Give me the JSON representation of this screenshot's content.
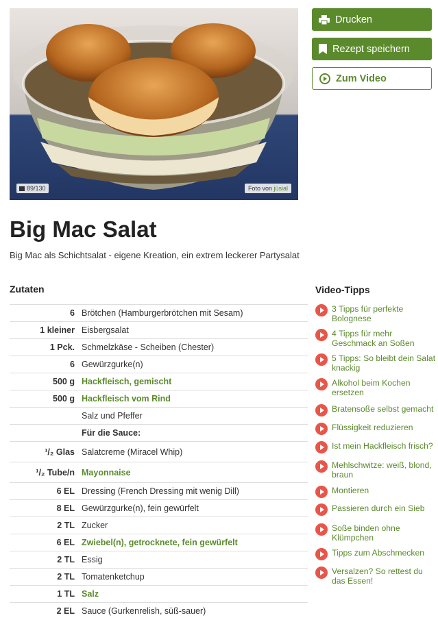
{
  "photo": {
    "counter": "89/130",
    "credit_prefix": "Foto von",
    "credit_author": "jüsial"
  },
  "actions": {
    "print": "Drucken",
    "save": "Rezept speichern",
    "video": "Zum Video"
  },
  "recipe": {
    "title": "Big Mac Salat",
    "subtitle": "Big Mac als Schichtsalat - eigene Kreation, ein extrem leckerer Partysalat"
  },
  "ingredients": {
    "heading": "Zutaten",
    "rows": [
      {
        "amount": "6",
        "name": "Brötchen (Hamburgerbrötchen mit Sesam)",
        "type": "plain"
      },
      {
        "amount": "1 kleiner",
        "name": "Eisbergsalat",
        "type": "plain"
      },
      {
        "amount": "1 Pck.",
        "name": "Schmelzkäse - Scheiben (Chester)",
        "type": "plain"
      },
      {
        "amount": "6",
        "name": "Gewürzgurke(n)",
        "type": "plain"
      },
      {
        "amount": "500 g",
        "name": "Hackfleisch, gemischt",
        "type": "link"
      },
      {
        "amount": "500 g",
        "name": "Hackfleisch vom Rind",
        "type": "link"
      },
      {
        "amount": "",
        "name": "Salz und Pfeffer",
        "type": "plain"
      },
      {
        "amount": "",
        "name": "Für die Sauce:",
        "type": "heading"
      },
      {
        "amount": "¹/₂ Glas",
        "name": "Salatcreme (Miracel Whip)",
        "type": "plain"
      },
      {
        "amount": "¹/₂ Tube/n",
        "name": "Mayonnaise",
        "type": "link"
      },
      {
        "amount": "6 EL",
        "name": "Dressing (French Dressing mit wenig Dill)",
        "type": "plain"
      },
      {
        "amount": "8 EL",
        "name": "Gewürzgurke(n), fein gewürfelt",
        "type": "plain"
      },
      {
        "amount": "2 TL",
        "name": "Zucker",
        "type": "plain"
      },
      {
        "amount": "6 EL",
        "name": "Zwiebel(n), getrocknete, fein gewürfelt",
        "type": "link"
      },
      {
        "amount": "2 TL",
        "name": "Essig",
        "type": "plain"
      },
      {
        "amount": "2 TL",
        "name": "Tomatenketchup",
        "type": "plain"
      },
      {
        "amount": "1 TL",
        "name": "Salz",
        "type": "link"
      },
      {
        "amount": "2 EL",
        "name": "Sauce (Gurkenrelish, süß-sauer)",
        "type": "plain"
      }
    ]
  },
  "tips": {
    "heading": "Video-Tipps",
    "items": [
      "3 Tipps für perfekte Bolognese",
      "4 Tipps für mehr Geschmack an Soßen",
      "5 Tipps: So bleibt dein Salat knackig",
      "Alkohol beim Kochen ersetzen",
      "Bratensoße selbst gemacht",
      "Flüssigkeit reduzieren",
      "Ist mein Hackfleisch frisch?",
      "Mehlschwitze: weiß, blond, braun",
      "Montieren",
      "Passieren durch ein Sieb",
      "Soße binden ohne Klümpchen",
      "Tipps zum Abschmecken",
      "Versalzen? So rettest du das Essen!"
    ]
  },
  "colors": {
    "brand_green": "#5b8a2d",
    "play_red": "#e8564a"
  }
}
